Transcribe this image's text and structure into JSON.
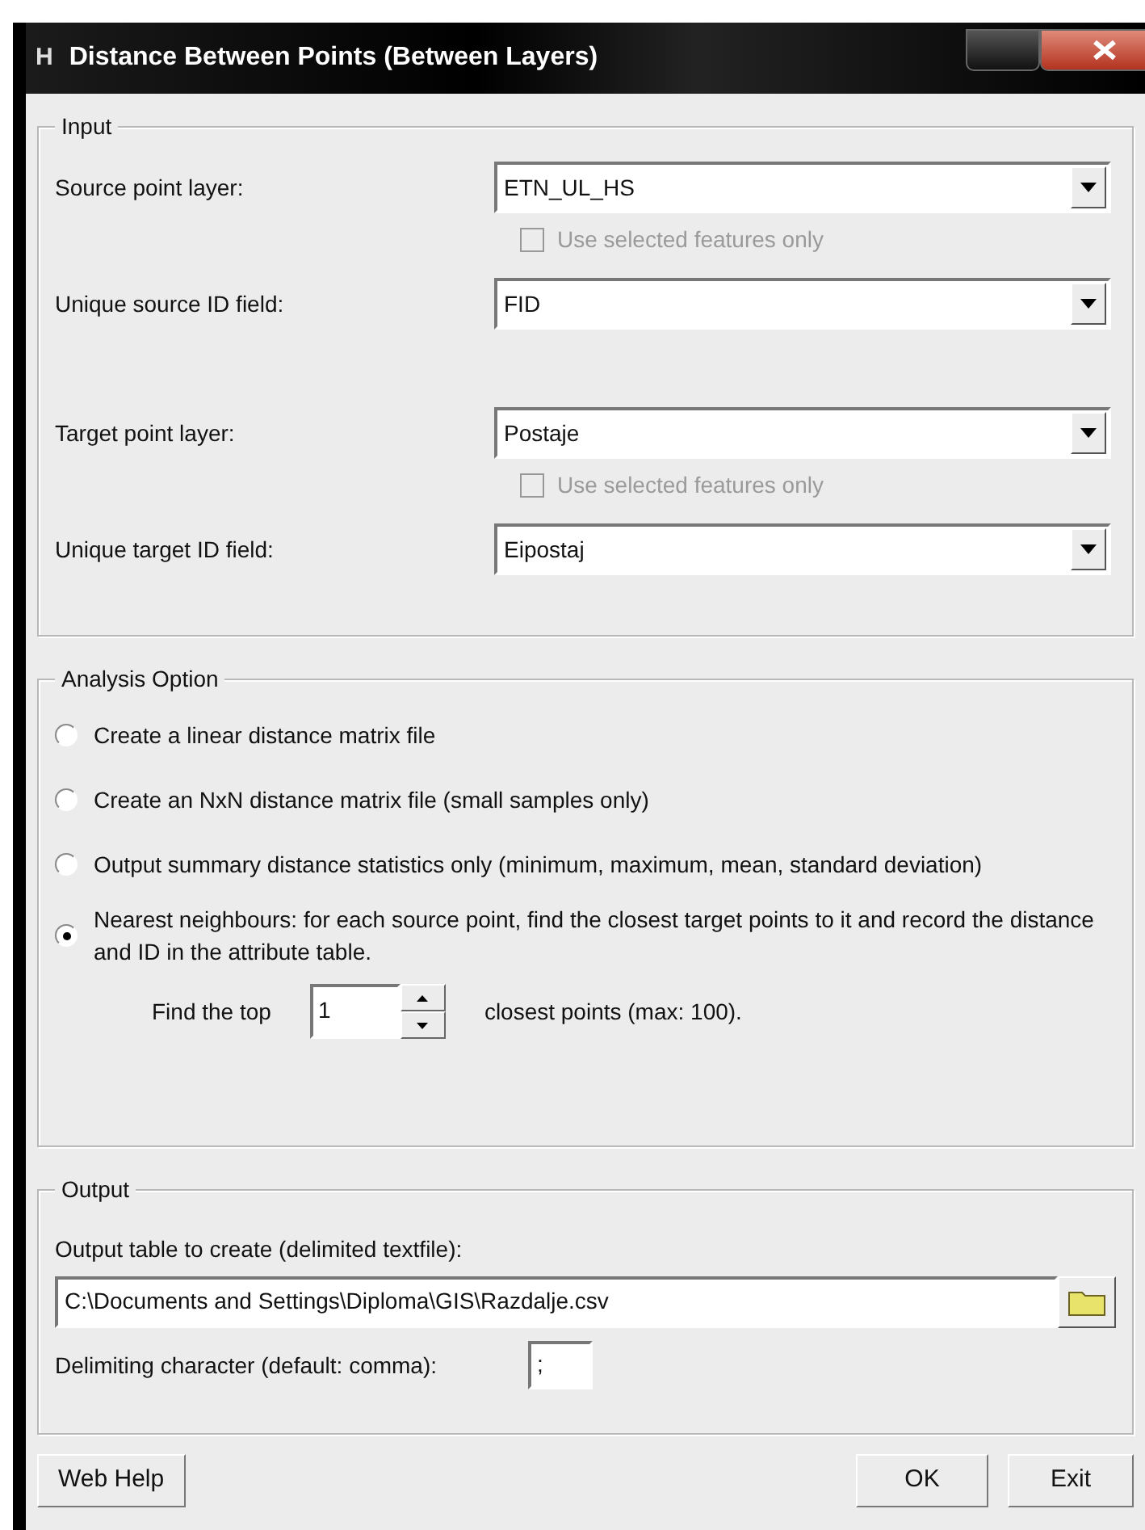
{
  "window": {
    "title_icon": "H",
    "title": "Distance Between Points (Between Layers)"
  },
  "input": {
    "legend": "Input",
    "fields": [
      {
        "kind": "combo",
        "label": "Source point layer:",
        "value": "ETN_UL_HS"
      },
      {
        "kind": "checkbox",
        "label": "Use selected features only",
        "checked": false,
        "disabled": true
      },
      {
        "kind": "combo",
        "label": "Unique source ID field:",
        "value": "FID"
      },
      {
        "kind": "combo",
        "label": "Target point layer:",
        "value": "Postaje"
      },
      {
        "kind": "checkbox",
        "label": "Use selected features only",
        "checked": false,
        "disabled": true
      },
      {
        "kind": "combo",
        "label": "Unique target ID field:",
        "value": "Eipostaj"
      }
    ]
  },
  "analysis": {
    "legend": "Analysis Option",
    "options": [
      {
        "label": "Create a linear distance matrix file",
        "selected": false
      },
      {
        "label": "Create an NxN distance matrix file (small samples only)",
        "selected": false
      },
      {
        "label": "Output summary distance statistics only (minimum, maximum, mean, standard deviation)",
        "selected": false
      },
      {
        "label": "Nearest neighbours: for each source point, find the closest target points to it and record the distance and ID in the attribute table.",
        "selected": true
      }
    ],
    "top_n": {
      "label_before": "Find the top",
      "value": "1",
      "label_after": "closest points (max: 100)."
    }
  },
  "output": {
    "legend": "Output",
    "table_label": "Output table to create (delimited textfile):",
    "path": "C:\\Documents and Settings\\Diploma\\GIS\\Razdalje.csv",
    "delimiter_label": "Delimiting character (default: comma):",
    "delimiter": ";"
  },
  "buttons": {
    "left": [
      "Web Help"
    ],
    "right": [
      "OK",
      "Exit"
    ]
  }
}
